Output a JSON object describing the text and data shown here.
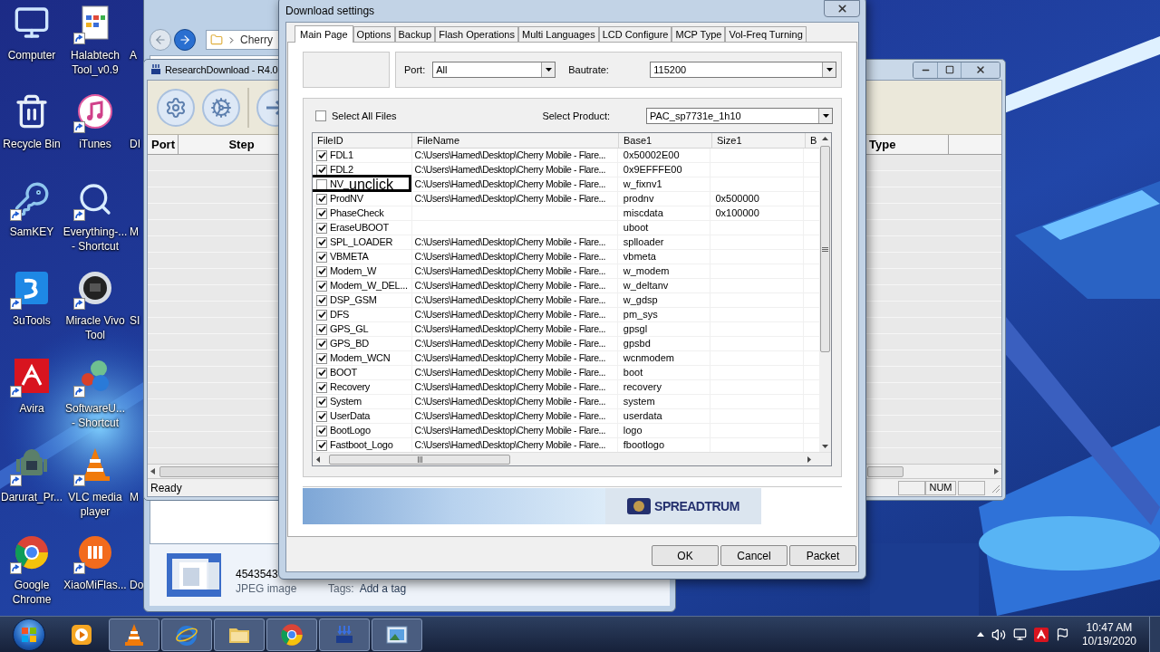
{
  "desktop": {
    "wallpaper": {
      "kind": "picture"
    },
    "icons": [
      {
        "lines": [
          "Computer"
        ],
        "shortcut": false
      },
      {
        "lines": [
          "Halabtech",
          "Tool_v0.9"
        ],
        "shortcut": true
      },
      {
        "lines": [
          "Recycle Bin"
        ],
        "shortcut": false
      },
      {
        "lines": [
          "iTunes"
        ],
        "shortcut": true
      },
      {
        "lines": [
          "SamKEY"
        ],
        "shortcut": true
      },
      {
        "lines": [
          "Everything-...",
          "- Shortcut"
        ],
        "shortcut": true
      },
      {
        "lines": [
          "3uTools"
        ],
        "shortcut": true
      },
      {
        "lines": [
          "Miracle Vivo",
          "Tool"
        ],
        "shortcut": true
      },
      {
        "lines": [
          "Avira"
        ],
        "shortcut": true
      },
      {
        "lines": [
          "SoftwareU...",
          "- Shortcut"
        ],
        "shortcut": true
      },
      {
        "lines": [
          "Darurat_Pr..."
        ],
        "shortcut": true
      },
      {
        "lines": [
          "VLC media",
          "player"
        ],
        "shortcut": true
      },
      {
        "lines": [
          "Google",
          "Chrome"
        ],
        "shortcut": true
      },
      {
        "lines": [
          "XiaoMiFlas..."
        ],
        "shortcut": true
      }
    ],
    "partial_labels": [
      "A",
      "DI",
      "M",
      "SI",
      "M",
      "Do"
    ]
  },
  "explorer": {
    "breadcrumb": "Cherry",
    "file": {
      "name": "4543543",
      "type": "JPEG image",
      "tags_label": "Tags:",
      "tags_value": "Add a tag"
    }
  },
  "research_download": {
    "title": "ResearchDownload - R4.0",
    "columns_left": [
      "Port",
      "Step"
    ],
    "columns_right": [
      "Type"
    ],
    "status": "Ready",
    "status_panes": [
      "NUM"
    ]
  },
  "dialog": {
    "title": "Download settings",
    "tabs": [
      {
        "label": "Main Page",
        "selected": true
      },
      {
        "label": "Options",
        "selected": false
      },
      {
        "label": "Backup",
        "selected": false
      },
      {
        "label": "Flash Operations",
        "selected": false
      },
      {
        "label": "Multi Languages",
        "selected": false
      },
      {
        "label": "LCD Configure",
        "selected": false
      },
      {
        "label": "MCP Type",
        "selected": false
      },
      {
        "label": "Vol-Freq Turning",
        "selected": false
      }
    ],
    "port": {
      "label": "Port:",
      "value": "All"
    },
    "baudrate": {
      "label": "Bautrate:",
      "value": "115200"
    },
    "select_all": {
      "label": "Select All Files",
      "checked": false
    },
    "product": {
      "label": "Select Product:",
      "value": "PAC_sp7731e_1h10"
    },
    "table": {
      "columns": [
        "FileID",
        "FileName",
        "Base1",
        "Size1",
        "B"
      ],
      "rows": [
        {
          "id": "FDL1",
          "checked": true,
          "file": "C:\\Users\\Hamed\\Desktop\\Cherry Mobile - Flare...",
          "base": "0x50002E00"
        },
        {
          "id": "FDL2",
          "checked": true,
          "file": "C:\\Users\\Hamed\\Desktop\\Cherry Mobile - Flare...",
          "base": "0x9EFFFE00"
        },
        {
          "id": "NV_",
          "checked": false,
          "file": "C:\\Users\\Hamed\\Desktop\\Cherry Mobile - Flare...",
          "base": "w_fixnv1"
        },
        {
          "id": "ProdNV",
          "checked": true,
          "file": "C:\\Users\\Hamed\\Desktop\\Cherry Mobile - Flare...",
          "base": "prodnv",
          "size": "0x500000"
        },
        {
          "id": "PhaseCheck",
          "checked": true,
          "base": "miscdata",
          "size": "0x100000"
        },
        {
          "id": "EraseUBOOT",
          "checked": true,
          "base": "uboot"
        },
        {
          "id": "SPL_LOADER",
          "checked": true,
          "file": "C:\\Users\\Hamed\\Desktop\\Cherry Mobile - Flare...",
          "base": "splloader"
        },
        {
          "id": "VBMETA",
          "checked": true,
          "file": "C:\\Users\\Hamed\\Desktop\\Cherry Mobile - Flare...",
          "base": "vbmeta"
        },
        {
          "id": "Modem_W",
          "checked": true,
          "file": "C:\\Users\\Hamed\\Desktop\\Cherry Mobile - Flare...",
          "base": "w_modem"
        },
        {
          "id": "Modem_W_DEL...",
          "checked": true,
          "file": "C:\\Users\\Hamed\\Desktop\\Cherry Mobile - Flare...",
          "base": "w_deltanv"
        },
        {
          "id": "DSP_GSM",
          "checked": true,
          "file": "C:\\Users\\Hamed\\Desktop\\Cherry Mobile - Flare...",
          "base": "w_gdsp"
        },
        {
          "id": "DFS",
          "checked": true,
          "file": "C:\\Users\\Hamed\\Desktop\\Cherry Mobile - Flare...",
          "base": "pm_sys"
        },
        {
          "id": "GPS_GL",
          "checked": true,
          "file": "C:\\Users\\Hamed\\Desktop\\Cherry Mobile - Flare...",
          "base": "gpsgl"
        },
        {
          "id": "GPS_BD",
          "checked": true,
          "file": "C:\\Users\\Hamed\\Desktop\\Cherry Mobile - Flare...",
          "base": "gpsbd"
        },
        {
          "id": "Modem_WCN",
          "checked": true,
          "file": "C:\\Users\\Hamed\\Desktop\\Cherry Mobile - Flare...",
          "base": "wcnmodem"
        },
        {
          "id": "BOOT",
          "checked": true,
          "file": "C:\\Users\\Hamed\\Desktop\\Cherry Mobile - Flare...",
          "base": "boot"
        },
        {
          "id": "Recovery",
          "checked": true,
          "file": "C:\\Users\\Hamed\\Desktop\\Cherry Mobile - Flare...",
          "base": "recovery"
        },
        {
          "id": "System",
          "checked": true,
          "file": "C:\\Users\\Hamed\\Desktop\\Cherry Mobile - Flare...",
          "base": "system"
        },
        {
          "id": "UserData",
          "checked": true,
          "file": "C:\\Users\\Hamed\\Desktop\\Cherry Mobile - Flare...",
          "base": "userdata"
        },
        {
          "id": "BootLogo",
          "checked": true,
          "file": "C:\\Users\\Hamed\\Desktop\\Cherry Mobile - Flare...",
          "base": "logo"
        },
        {
          "id": "Fastboot_Logo",
          "checked": true,
          "file": "C:\\Users\\Hamed\\Desktop\\Cherry Mobile - Flare...",
          "base": "fbootlogo"
        }
      ],
      "annotation": "unclick"
    },
    "banner": {
      "logo_text": "SPREADTRUM"
    },
    "buttons": [
      "OK",
      "Cancel",
      "Packet"
    ]
  },
  "taskbar": {
    "pinned": [
      {
        "running": false
      },
      {
        "running": true
      },
      {
        "running": true
      },
      {
        "running": true
      },
      {
        "running": true
      },
      {
        "running": true
      },
      {
        "running": true
      }
    ],
    "clock": {
      "time": "10:47 AM",
      "date": "10/19/2020"
    }
  }
}
